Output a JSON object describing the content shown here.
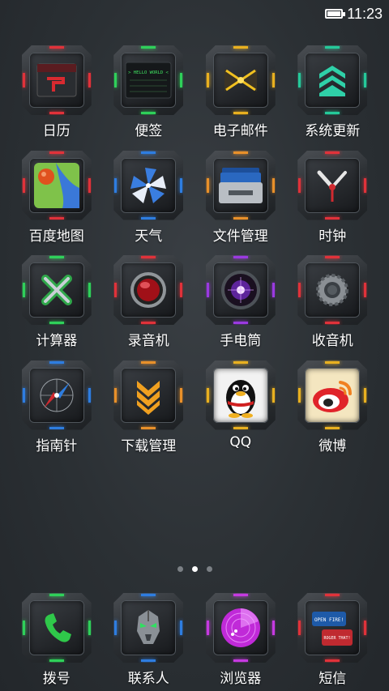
{
  "status_bar": {
    "time": "11:23",
    "battery_level": 1.0
  },
  "apps": [
    {
      "label": "日历",
      "icon": "calendar-icon",
      "accent": "#e0323a"
    },
    {
      "label": "便签",
      "icon": "notes-icon",
      "accent": "#2fd05a",
      "tile_text": "> HELLO WORLD <"
    },
    {
      "label": "电子邮件",
      "icon": "email-icon",
      "accent": "#e8b020"
    },
    {
      "label": "系统更新",
      "icon": "system-update-icon",
      "accent": "#25c99a"
    },
    {
      "label": "百度地图",
      "icon": "map-icon",
      "accent": "#e0323a"
    },
    {
      "label": "天气",
      "icon": "weather-icon",
      "accent": "#2e7de0"
    },
    {
      "label": "文件管理",
      "icon": "file-manager-icon",
      "accent": "#e8902a"
    },
    {
      "label": "时钟",
      "icon": "clock-icon",
      "accent": "#e0323a"
    },
    {
      "label": "计算器",
      "icon": "calculator-icon",
      "accent": "#2fd05a"
    },
    {
      "label": "录音机",
      "icon": "recorder-icon",
      "accent": "#e0323a"
    },
    {
      "label": "手电筒",
      "icon": "flashlight-icon",
      "accent": "#9a3ae0"
    },
    {
      "label": "收音机",
      "icon": "radio-icon",
      "accent": "#e0323a"
    },
    {
      "label": "指南针",
      "icon": "compass-icon",
      "accent": "#2e7de0"
    },
    {
      "label": "下载管理",
      "icon": "download-manager-icon",
      "accent": "#e8902a"
    },
    {
      "label": "QQ",
      "icon": "qq-penguin-icon",
      "accent": "#e8b020"
    },
    {
      "label": "微博",
      "icon": "weibo-icon",
      "accent": "#e8b020"
    }
  ],
  "pager": {
    "pages": 3,
    "current": 2
  },
  "dock": [
    {
      "label": "拨号",
      "icon": "phone-icon",
      "accent": "#2fd05a"
    },
    {
      "label": "联系人",
      "icon": "contacts-icon",
      "accent": "#2e7de0"
    },
    {
      "label": "浏览器",
      "icon": "browser-icon",
      "accent": "#c53ae0"
    },
    {
      "label": "短信",
      "icon": "messages-icon",
      "accent": "#e0323a",
      "tile_text_1": "OPEN FIRE!",
      "tile_text_2": "ROGER THAT!"
    }
  ]
}
